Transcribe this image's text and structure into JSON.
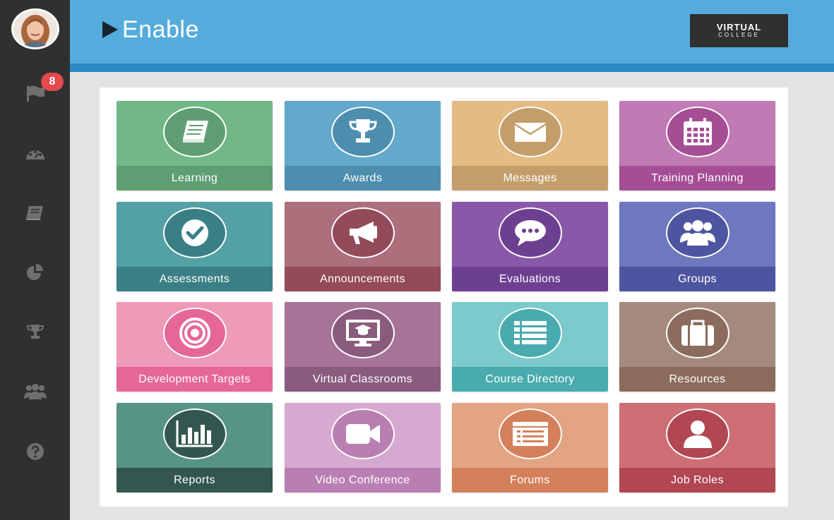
{
  "header": {
    "title": "Enable",
    "logo_top": "VIRTUAL",
    "logo_bottom": "COLLEGE"
  },
  "sidebar": {
    "notification_count": "8",
    "items": [
      {
        "icon": "flag-icon"
      },
      {
        "icon": "dashboard-icon"
      },
      {
        "icon": "book-icon"
      },
      {
        "icon": "pie-chart-icon"
      },
      {
        "icon": "trophy-icon"
      },
      {
        "icon": "users-icon"
      },
      {
        "icon": "help-icon"
      }
    ]
  },
  "tiles": [
    {
      "label": "Learning",
      "icon": "book-icon",
      "top": "#72b886",
      "bottom": "#5f9e72",
      "circle": "#5f9e72"
    },
    {
      "label": "Awards",
      "icon": "trophy-icon",
      "top": "#62a9cc",
      "bottom": "#4d8eae",
      "circle": "#4d8eae"
    },
    {
      "label": "Messages",
      "icon": "envelope-icon",
      "top": "#e3bc83",
      "bottom": "#c39e6b",
      "circle": "#c39e6b"
    },
    {
      "label": "Training Planning",
      "icon": "calendar-icon",
      "top": "#c07ab4",
      "bottom": "#a54d95",
      "circle": "#a54d95"
    },
    {
      "label": "Assessments",
      "icon": "checkmark-icon",
      "top": "#53a0a5",
      "bottom": "#3a7f85",
      "circle": "#3a7f85"
    },
    {
      "label": "Announcements",
      "icon": "megaphone-icon",
      "top": "#ad6f7c",
      "bottom": "#934a59",
      "circle": "#934a59"
    },
    {
      "label": "Evaluations",
      "icon": "chat-bubble-icon",
      "top": "#8a58a8",
      "bottom": "#6d3f91",
      "circle": "#6d3f91"
    },
    {
      "label": "Groups",
      "icon": "users-icon",
      "top": "#6e78be",
      "bottom": "#4e55a0",
      "circle": "#4e55a0"
    },
    {
      "label": "Development Targets",
      "icon": "target-icon",
      "top": "#ee9ab9",
      "bottom": "#e56797",
      "circle": "#e56797"
    },
    {
      "label": "Virtual Classrooms",
      "icon": "monitor-graduation-icon",
      "top": "#a57497",
      "bottom": "#8a5b7d",
      "circle": "#8a5b7d"
    },
    {
      "label": "Course Directory",
      "icon": "list-icon",
      "top": "#7ccacb",
      "bottom": "#4aabae",
      "circle": "#4aabae"
    },
    {
      "label": "Resources",
      "icon": "briefcase-icon",
      "top": "#a48a7e",
      "bottom": "#8b6b5c",
      "circle": "#8b6b5c"
    },
    {
      "label": "Reports",
      "icon": "bar-chart-icon",
      "top": "#579484",
      "bottom": "#33574f",
      "circle": "#33574f"
    },
    {
      "label": "Video Conference",
      "icon": "video-camera-icon",
      "top": "#d6a9d0",
      "bottom": "#b97fb3",
      "circle": "#b97fb3"
    },
    {
      "label": "Forums",
      "icon": "forum-icon",
      "top": "#e2a482",
      "bottom": "#d4805a",
      "circle": "#d4805a"
    },
    {
      "label": "Job Roles",
      "icon": "user-icon",
      "top": "#cd6f75",
      "bottom": "#b04752",
      "circle": "#b04752"
    }
  ]
}
